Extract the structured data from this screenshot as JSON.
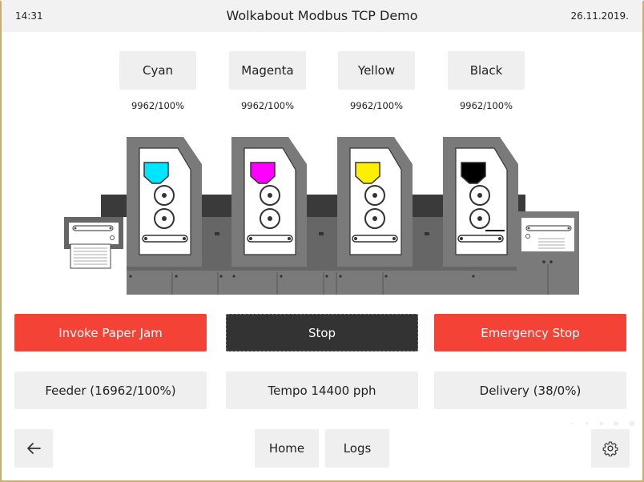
{
  "header": {
    "time": "14:31",
    "title": "Wolkabout Modbus TCP Demo",
    "date": "26.11.2019."
  },
  "inks": [
    {
      "label": "Cyan",
      "level": "9962/100%",
      "color": "#00e5ff"
    },
    {
      "label": "Magenta",
      "level": "9962/100%",
      "color": "#ff00ff"
    },
    {
      "label": "Yellow",
      "level": "9962/100%",
      "color": "#ffee00"
    },
    {
      "label": "Black",
      "level": "9962/100%",
      "color": "#000000"
    }
  ],
  "actions": {
    "paper_jam": "Invoke Paper Jam",
    "stop": "Stop",
    "emergency": "Emergency Stop"
  },
  "status": {
    "feeder": "Feeder (16962/100%)",
    "tempo": "Tempo 14400 pph",
    "delivery": "Delivery (38/0%)"
  },
  "nav": {
    "home": "Home",
    "logs": "Logs"
  },
  "colors": {
    "accent_red": "#f44336",
    "dark_button": "#333333",
    "button_bg": "#efefef",
    "frame": "#c9ae6f"
  },
  "icons": {
    "back": "arrow-left-icon",
    "settings": "gear-icon"
  }
}
